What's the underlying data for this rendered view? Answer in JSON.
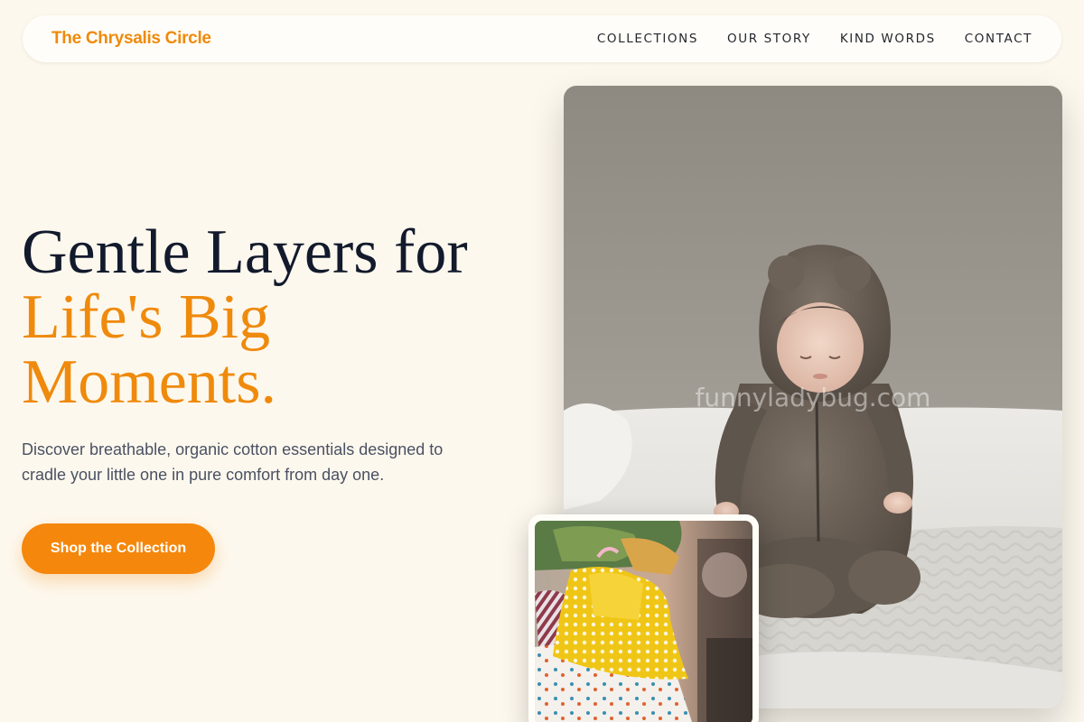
{
  "brand": {
    "name": "The Chrysalis Circle"
  },
  "nav": {
    "items": [
      "COLLECTIONS",
      "OUR STORY",
      "KIND WORDS",
      "CONTACT"
    ]
  },
  "hero": {
    "headline_line1": "Gentle Layers for",
    "headline_accent_line1": "Life's Big",
    "headline_accent_line2": "Moments.",
    "description": "Discover breathable, organic cotton essentials designed to cradle your little one in pure comfort from day one.",
    "cta_label": "Shop the Collection"
  },
  "images": {
    "main_alt": "Baby in a brown fleece bear-ear hooded onesie sitting on a white blanket",
    "secondary_alt": "Rack of colorful children's clothing including a yellow polka-dot dress",
    "watermark": "funnyladybug.com"
  },
  "colors": {
    "accent": "#ef8a0c",
    "cta": "#f5870c",
    "background": "#fdf8ee",
    "heading": "#121a2c",
    "body_text": "#4a5162"
  }
}
